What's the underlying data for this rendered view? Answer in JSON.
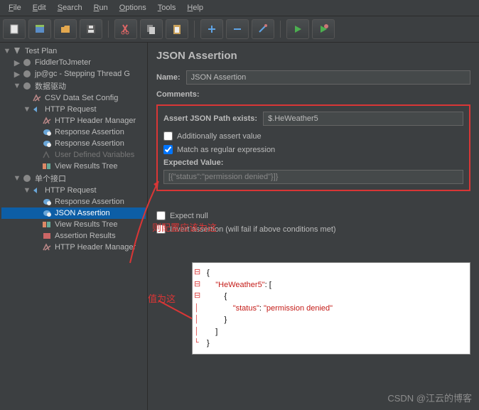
{
  "menu": {
    "file": "File",
    "edit": "Edit",
    "search": "Search",
    "run": "Run",
    "options": "Options",
    "tools": "Tools",
    "help": "Help"
  },
  "tree": {
    "root": "Test Plan",
    "items": [
      "FiddlerToJmeter",
      "jp@gc - Stepping Thread G",
      "数据驱动",
      "CSV Data Set Config",
      "HTTP Request",
      "HTTP Header Manager",
      "Response Assertion",
      "Response Assertion",
      "User Defined Variables",
      "View Results Tree",
      "单个接口",
      "HTTP Request",
      "Response Assertion",
      "JSON Assertion",
      "View Results Tree",
      "Assertion Results",
      "HTTP Header Manager"
    ]
  },
  "panel": {
    "title": "JSON Assertion",
    "nameLabel": "Name:",
    "nameValue": "JSON Assertion",
    "commentsLabel": "Comments:",
    "assertPathLabel": "Assert JSON Path exists:",
    "assertPathValue": "$.HeWeather5",
    "chkAdditional": "Additionally assert value",
    "chkMatch": "Match as regular expression",
    "expectedLabel": "Expected Value:",
    "expectedValue": "[{\"status\":\"permission denied\"}]}",
    "chkExpectNull": "Expect null",
    "chkInvert": "Invert assertion (will fail if above conditions met)"
  },
  "annotations": {
    "a1": "则配置应该为这",
    "a2": "值为这"
  },
  "code": {
    "l1": "{",
    "l2": "    \"HeWeather5\": [",
    "l3": "        {",
    "l4": "            \"status\": \"permission denied\"",
    "l5": "        }",
    "l6": "    ]",
    "l7": "}"
  },
  "watermark": "CSDN @江云的博客"
}
